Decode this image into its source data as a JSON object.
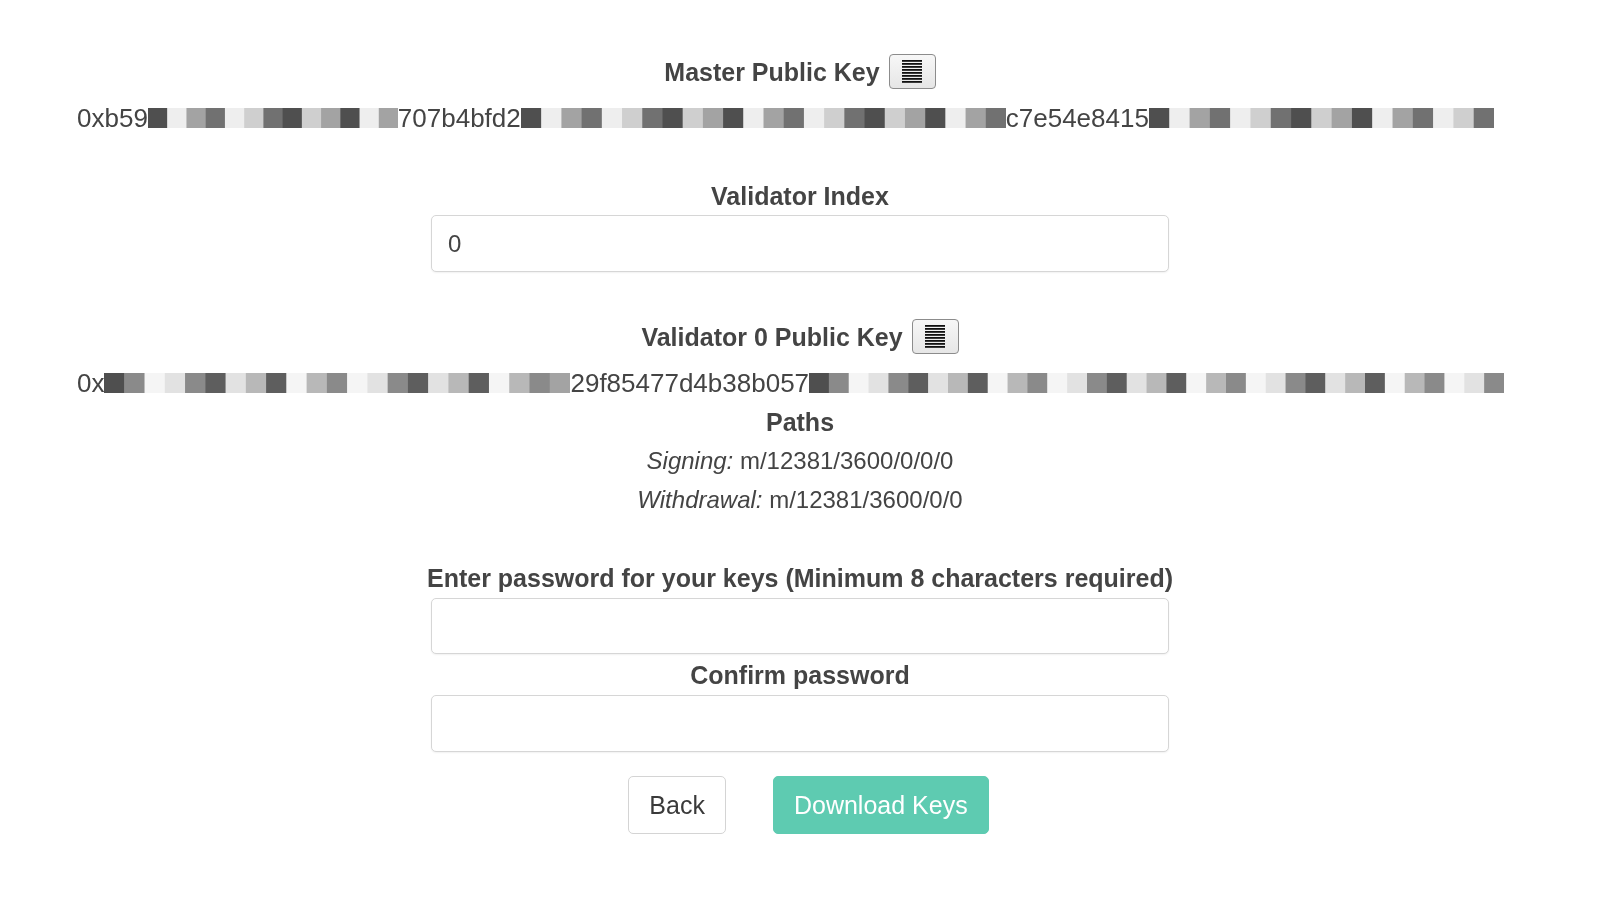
{
  "master_public_key": {
    "label": "Master Public Key",
    "value_segments": [
      {
        "kind": "text",
        "text": "0xb59"
      },
      {
        "kind": "redacted"
      },
      {
        "kind": "text",
        "text": "707b4bfd2"
      },
      {
        "kind": "redacted"
      },
      {
        "kind": "text",
        "text": "c7e54e8415"
      },
      {
        "kind": "redacted"
      }
    ]
  },
  "validator_index": {
    "label": "Validator Index",
    "value": "0"
  },
  "validator_public_key": {
    "label": "Validator 0 Public Key",
    "value_segments": [
      {
        "kind": "text",
        "text": "0x"
      },
      {
        "kind": "redacted"
      },
      {
        "kind": "text",
        "text": "29f85477d4b38b057"
      },
      {
        "kind": "redacted"
      }
    ]
  },
  "paths": {
    "title": "Paths",
    "lines": [
      "*Signing:* m/12381/3600/0/0/0",
      "*Withdrawal:* m/12381/3600/0/0"
    ]
  },
  "password": {
    "label": "Enter password for your keys (Minimum 8 characters required)"
  },
  "confirm_password": {
    "label": "Confirm password"
  },
  "buttons": [
    {
      "label": "Back",
      "kind": "secondary"
    },
    {
      "label": "Download Keys",
      "kind": "primary"
    }
  ]
}
